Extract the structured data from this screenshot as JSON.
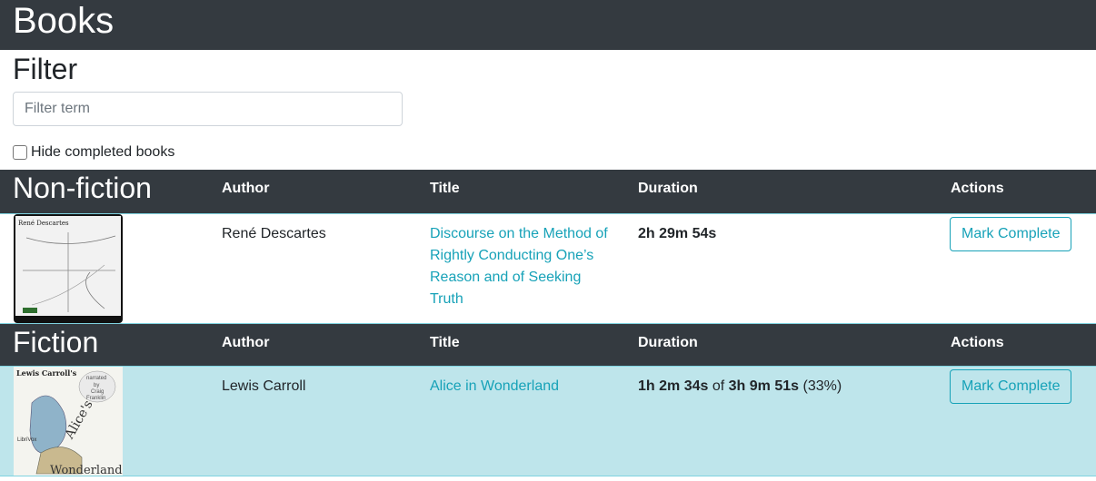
{
  "app": {
    "title": "Books"
  },
  "filter": {
    "heading": "Filter",
    "placeholder": "Filter term",
    "value": "",
    "hide_completed_label": "Hide completed books",
    "hide_completed_checked": false
  },
  "columns": {
    "author": "Author",
    "title": "Title",
    "duration": "Duration",
    "actions": "Actions"
  },
  "groups": [
    {
      "name": "Non-fiction",
      "books": [
        {
          "cover_icon": "book-cover-descartes",
          "author": "René Descartes",
          "title": "Discourse on the Method of Rightly Conducting One’s Reason and of Seeking Truth",
          "duration": "2h 29m 54s",
          "action": "Mark Complete"
        }
      ]
    },
    {
      "name": "Fiction",
      "books": [
        {
          "cover_icon": "book-cover-alice",
          "author": "Lewis Carroll",
          "title": "Alice in Wonderland",
          "progress": "1h 2m 34s",
          "of": "of",
          "duration": "3h 9m 51s",
          "percent": "(33%)",
          "action": "Mark Complete"
        }
      ]
    }
  ],
  "colors": {
    "header_bg": "#343a40",
    "link": "#17a2b8",
    "active_row": "#bee5eb"
  }
}
